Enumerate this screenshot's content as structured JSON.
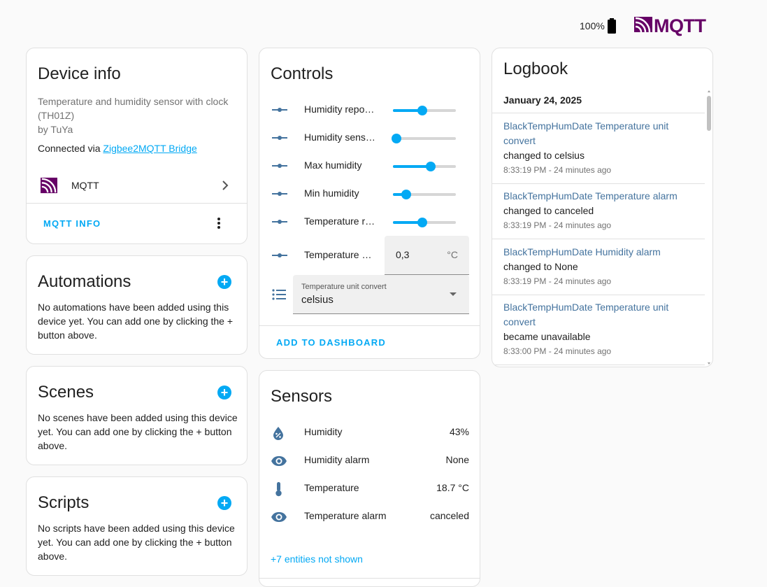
{
  "topbar": {
    "battery": "100%",
    "brand": "MQTT",
    "battery_icon": "battery-full-icon",
    "brand_icon": "mqtt-logo-icon"
  },
  "colors": {
    "accent": "#03a9f4",
    "mqtt_brand": "#660066",
    "log_entity": "#44739e"
  },
  "device_info": {
    "title": "Device info",
    "description": "Temperature and humidity sensor with clock (TH01Z)",
    "manufacturer": "by TuYa",
    "connected_prefix": "Connected via",
    "connected_link": "Zigbee2MQTT Bridge",
    "integration_label": "MQTT",
    "action_button": "MQTT INFO"
  },
  "automations": {
    "title": "Automations",
    "text": "No automations have been added using this device yet. You can add one by clicking the + button above."
  },
  "scenes": {
    "title": "Scenes",
    "text": "No scenes have been added using this device yet. You can add one by clicking the + button above."
  },
  "scripts": {
    "title": "Scripts",
    "text": "No scripts have been added using this device yet. You can add one by clicking the + button above."
  },
  "controls": {
    "title": "Controls",
    "sliders": [
      {
        "label": "Humidity repo…",
        "level": 0.47
      },
      {
        "label": "Humidity sens…",
        "level": 0.06
      },
      {
        "label": "Max humidity",
        "level": 0.6
      },
      {
        "label": "Min humidity",
        "level": 0.21
      },
      {
        "label": "Temperature r…",
        "level": 0.47
      }
    ],
    "number": {
      "label": "Temperature …",
      "value": "0,3",
      "unit": "°C"
    },
    "select": {
      "field_label": "Temperature unit convert",
      "value": "celsius"
    },
    "action_button": "ADD TO DASHBOARD"
  },
  "sensors": {
    "title": "Sensors",
    "items": [
      {
        "label": "Humidity",
        "value": "43%",
        "icon": "water-percent-icon"
      },
      {
        "label": "Humidity alarm",
        "value": "None",
        "icon": "eye-icon"
      },
      {
        "label": "Temperature",
        "value": "18.7 °C",
        "icon": "thermometer-icon"
      },
      {
        "label": "Temperature alarm",
        "value": "canceled",
        "icon": "eye-icon"
      }
    ],
    "more_link": "+7 entities not shown"
  },
  "logbook": {
    "title": "Logbook",
    "date": "January 24, 2025",
    "entries": [
      {
        "entity": "BlackTempHumDate Temperature unit convert",
        "message": "changed to celsius",
        "time": "8:33:19 PM - 24 minutes ago"
      },
      {
        "entity": "BlackTempHumDate Temperature alarm",
        "message": "changed to canceled",
        "time": "8:33:19 PM - 24 minutes ago"
      },
      {
        "entity": "BlackTempHumDate Humidity alarm",
        "message": "changed to None",
        "time": "8:33:19 PM - 24 minutes ago"
      },
      {
        "entity": "BlackTempHumDate Temperature unit convert",
        "message": "became unavailable",
        "time": "8:33:00 PM - 24 minutes ago"
      }
    ]
  }
}
